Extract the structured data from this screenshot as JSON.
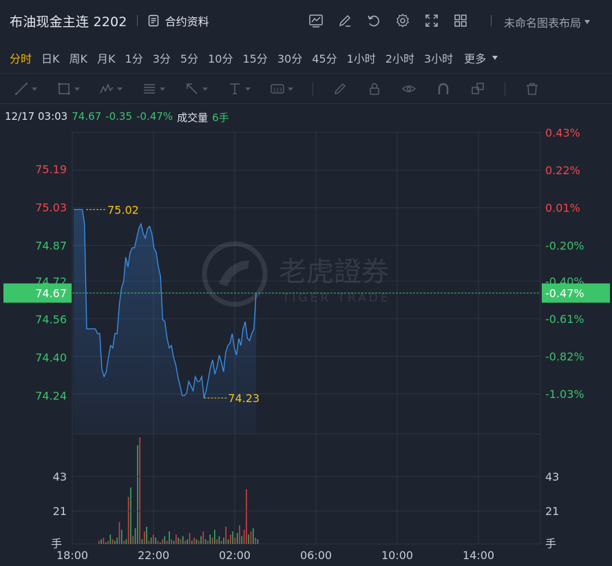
{
  "header": {
    "title": "布油现金主连 2202",
    "contract_info_label": "合约资料",
    "layout_name": "未命名图表布局",
    "icons": [
      "chart-style-icon",
      "edit-icon",
      "refresh-icon",
      "settings-icon",
      "fullscreen-icon",
      "grid-layout-icon"
    ]
  },
  "periods": {
    "items": [
      "分时",
      "日K",
      "周K",
      "月K",
      "1分",
      "3分",
      "5分",
      "10分",
      "15分",
      "30分",
      "45分",
      "1小时",
      "2小时",
      "3小时",
      "更多"
    ],
    "active": "分时"
  },
  "drawing_tools": [
    "line-tool-icon",
    "rectangle-tool-icon",
    "wave-tool-icon",
    "fib-tool-icon",
    "arrow-tool-icon",
    "text-tool-icon",
    "number-tool-icon",
    "pen-icon",
    "lock-icon",
    "eye-icon",
    "magnet-icon",
    "layers-icon",
    "trash-icon"
  ],
  "info": {
    "datetime": "12/17 03:03",
    "price": "74.67",
    "change": "-0.35",
    "change_pct": "-0.47%",
    "volume_label": "成交量",
    "volume": "6手"
  },
  "watermark": {
    "cn": "老虎證券",
    "en": "TIGER TRADE"
  },
  "colors": {
    "up": "#f04848",
    "down": "#3cc46a",
    "line": "#3a8ee6",
    "annot": "#f5c518",
    "current": "#3cc46a"
  },
  "chart_data": {
    "type": "line",
    "price_ticks_left": [
      "75.19",
      "75.03",
      "74.87",
      "74.72",
      "74.56",
      "74.40",
      "74.24"
    ],
    "price_ticks_right": [
      "0.43%",
      "0.22%",
      "0.01%",
      "-0.20%",
      "-0.40%",
      "-0.61%",
      "-0.82%",
      "-1.03%"
    ],
    "ylim": [
      74.08,
      75.35
    ],
    "prev_close": 75.02,
    "current_price_label": "74.67",
    "current_pct_label": "-0.47%",
    "high_label": "75.02",
    "low_label": "74.23",
    "x_ticks": [
      "18:00",
      "22:00",
      "02:00",
      "06:00",
      "10:00",
      "14:00"
    ],
    "series": [
      {
        "values": [
          75.02,
          75.02,
          75.02,
          75.02,
          75.02,
          74.96,
          74.52,
          74.52,
          74.52,
          74.52,
          74.52,
          74.5,
          74.5,
          74.35,
          74.32,
          74.34,
          74.4,
          74.45,
          74.44,
          74.5,
          74.5,
          74.62,
          74.69,
          74.72,
          74.82,
          74.78,
          74.84,
          74.86,
          74.86,
          74.9,
          74.94,
          74.96,
          74.92,
          74.9,
          74.94,
          74.95,
          74.92,
          74.86,
          74.84,
          74.78,
          74.74,
          74.56,
          74.55,
          74.48,
          74.44,
          74.45,
          74.4,
          74.37,
          74.32,
          74.28,
          74.24,
          74.24,
          74.25,
          74.3,
          74.28,
          74.26,
          74.32,
          74.3,
          74.3,
          74.32,
          74.23,
          74.26,
          74.31,
          74.36,
          74.39,
          74.33,
          74.36,
          74.41,
          74.38,
          74.34,
          74.42,
          74.45,
          74.46,
          74.5,
          74.44,
          74.41,
          74.48,
          74.45,
          74.52,
          74.55,
          74.48,
          74.47,
          74.5,
          74.52,
          74.67
        ]
      }
    ],
    "volume": {
      "ticks": [
        "43",
        "21",
        "手"
      ],
      "ymax": 65,
      "bars": [
        2,
        3,
        4,
        1,
        2,
        6,
        3,
        2,
        4,
        14,
        9,
        2,
        3,
        30,
        36,
        5,
        10,
        63,
        68,
        3,
        8,
        11,
        2,
        4,
        6,
        4,
        2,
        1,
        3,
        5,
        2,
        8,
        3,
        2,
        6,
        4,
        3,
        5,
        2,
        3,
        7,
        2,
        4,
        3,
        2,
        5,
        8,
        3,
        2,
        6,
        4,
        9,
        3,
        5,
        2,
        4,
        11,
        3,
        6,
        8,
        4,
        7,
        12,
        5,
        9,
        35,
        6,
        8,
        10,
        4,
        3
      ],
      "up_flags": [
        1,
        0,
        1,
        0,
        1,
        0,
        1,
        0,
        0,
        1,
        0,
        1,
        0,
        1,
        0,
        1,
        0,
        0,
        1,
        0,
        1,
        0,
        1,
        0,
        1,
        0,
        1,
        0,
        1,
        0,
        1,
        0,
        1,
        0,
        1,
        0,
        1,
        0,
        1,
        0,
        1,
        0,
        1,
        0,
        1,
        0,
        1,
        0,
        1,
        0,
        1,
        0,
        1,
        0,
        1,
        0,
        1,
        0,
        1,
        0,
        1,
        0,
        1,
        0,
        1,
        1,
        0,
        1,
        0,
        1,
        0
      ]
    }
  }
}
